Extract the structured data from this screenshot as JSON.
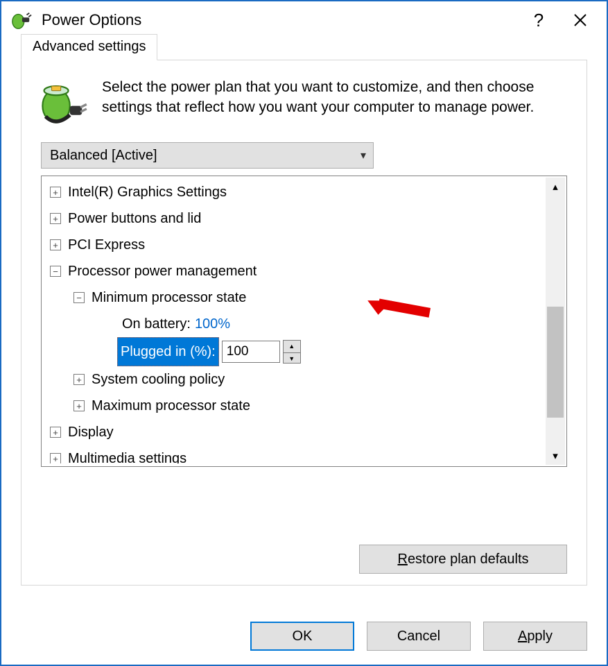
{
  "title": "Power Options",
  "tab": "Advanced settings",
  "intro": "Select the power plan that you want to customize, and then choose settings that reflect how you want your computer to manage power.",
  "plan_dropdown": "Balanced [Active]",
  "tree": {
    "graphics": "Intel(R) Graphics Settings",
    "powerbtn": "Power buttons and lid",
    "pci": "PCI Express",
    "proc": "Processor power management",
    "minstate": "Minimum processor state",
    "onbattery_label": "On battery:",
    "onbattery_value": "100%",
    "plugged_label": "Plugged in (%):",
    "plugged_value": "100",
    "cooling": "System cooling policy",
    "maxstate": "Maximum processor state",
    "display": "Display",
    "multimedia": "Multimedia settings"
  },
  "restore_btn": "Restore plan defaults",
  "buttons": {
    "ok": "OK",
    "cancel": "Cancel",
    "apply": "Apply"
  }
}
